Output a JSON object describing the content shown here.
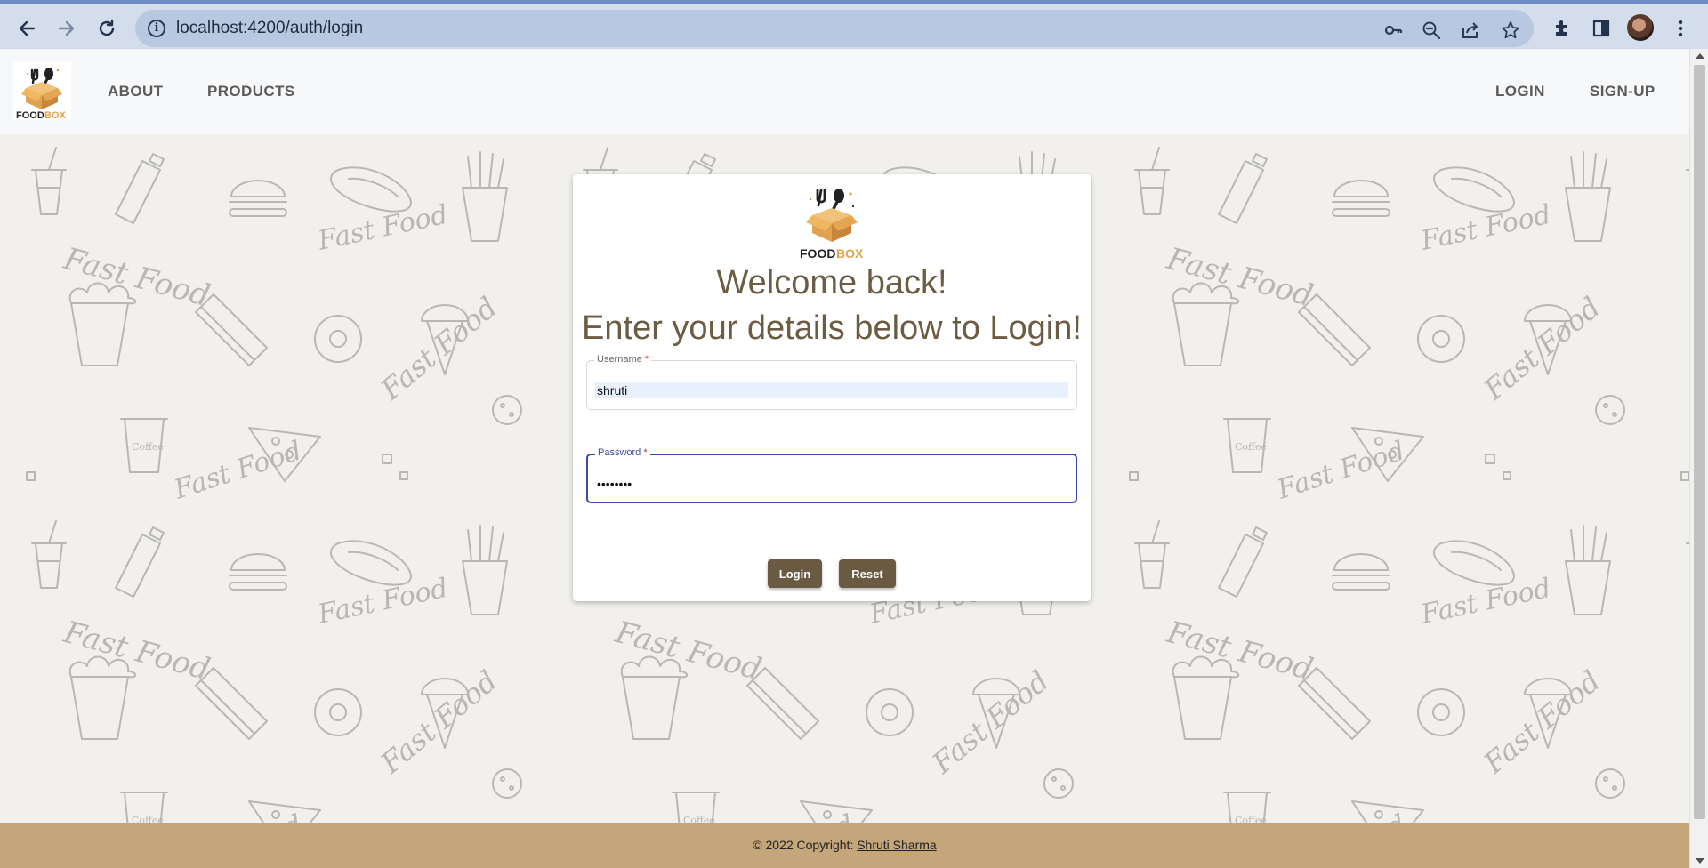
{
  "browser": {
    "url": "localhost:4200/auth/login",
    "icons": [
      "back-arrow-icon",
      "forward-arrow-icon",
      "reload-icon",
      "site-info-icon",
      "key-icon",
      "zoom-out-icon",
      "share-icon",
      "star-icon",
      "extensions-icon",
      "side-panel-icon",
      "profile-avatar",
      "menu-kebab-icon"
    ]
  },
  "brand": {
    "name_food": "FOOD",
    "name_box": "BOX"
  },
  "nav": {
    "about": "ABOUT",
    "products": "PRODUCTS",
    "login": "LOGIN",
    "signup": "SIGN-UP"
  },
  "login_card": {
    "welcome": "Welcome back!",
    "subtitle": "Enter your details below to Login!",
    "username": {
      "label": "Username",
      "required_mark": "*",
      "value": "shruti"
    },
    "password": {
      "label": "Password",
      "required_mark": "*",
      "value": "••••••••"
    },
    "login_button": "Login",
    "reset_button": "Reset"
  },
  "footer": {
    "copyright": "© 2022 Copyright:",
    "author": "Shruti Sharma"
  },
  "background_pattern_text": "Fast Food",
  "colors": {
    "brand_brown": "#6b5a42",
    "heading": "#6c5c43",
    "footer": "#c5a57a",
    "logo_orange": "#e0a24d",
    "focus_blue": "#3b4aa0"
  }
}
